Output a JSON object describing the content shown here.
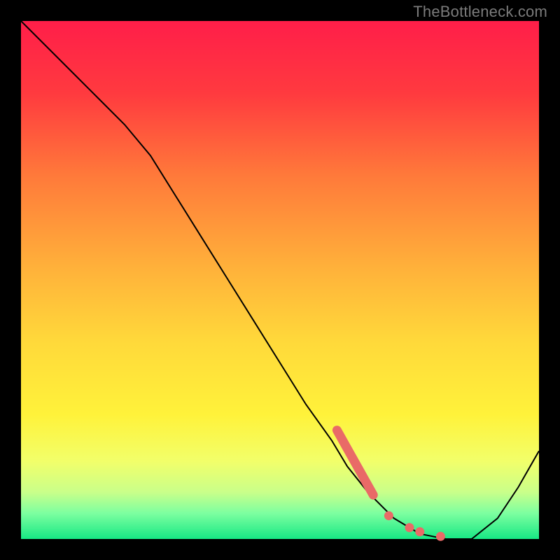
{
  "watermark": "TheBottleneck.com",
  "colors": {
    "bg_black": "#000000",
    "curve": "#000000",
    "marker": "#e96a67",
    "watermark_text": "#7b7b7b"
  },
  "chart_data": {
    "type": "line",
    "title": "",
    "xlabel": "",
    "ylabel": "",
    "xlim": [
      0,
      100
    ],
    "ylim": [
      0,
      100
    ],
    "grid": false,
    "legend": false,
    "background": "vertical rainbow gradient (red→orange→yellow→green) inside black frame",
    "series": [
      {
        "name": "bottleneck-curve",
        "x": [
          0,
          5,
          10,
          15,
          20,
          25,
          30,
          35,
          40,
          45,
          50,
          55,
          60,
          63,
          67,
          72,
          77,
          82,
          87,
          92,
          96,
          100
        ],
        "y": [
          100,
          95,
          90,
          85,
          80,
          74,
          66,
          58,
          50,
          42,
          34,
          26,
          19,
          14,
          9,
          4,
          1,
          0,
          0,
          4,
          10,
          17
        ]
      }
    ],
    "markers": [
      {
        "name": "highlight-segment",
        "shape": "thick-rounded-line",
        "x0": 61,
        "y0": 21,
        "x1": 68,
        "y1": 8.5
      },
      {
        "name": "dot-1",
        "shape": "dot",
        "x": 71,
        "y": 4.5
      },
      {
        "name": "dot-2",
        "shape": "dot",
        "x": 75,
        "y": 2.2
      },
      {
        "name": "dot-3",
        "shape": "dot",
        "x": 77,
        "y": 1.4
      },
      {
        "name": "dot-4",
        "shape": "dot",
        "x": 81,
        "y": 0.5
      }
    ],
    "gradient_stops": [
      {
        "pct": 0,
        "color": "#ff1e49"
      },
      {
        "pct": 14,
        "color": "#ff3a3f"
      },
      {
        "pct": 30,
        "color": "#ff7a3a"
      },
      {
        "pct": 48,
        "color": "#ffb23a"
      },
      {
        "pct": 62,
        "color": "#ffd93a"
      },
      {
        "pct": 76,
        "color": "#fff23a"
      },
      {
        "pct": 85,
        "color": "#f2ff6a"
      },
      {
        "pct": 91,
        "color": "#c9ff8a"
      },
      {
        "pct": 95,
        "color": "#7dffa0"
      },
      {
        "pct": 100,
        "color": "#17e884"
      }
    ]
  }
}
